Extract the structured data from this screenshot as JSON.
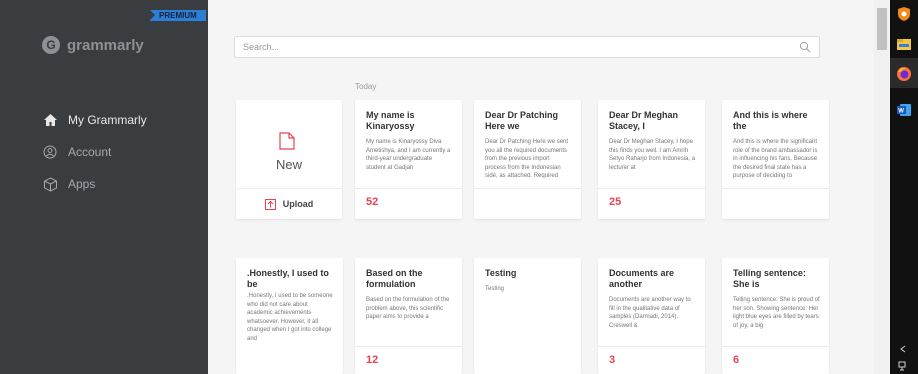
{
  "sidebar": {
    "premium_badge": "PREMIUM",
    "logo_text": "grammarly",
    "logo_glyph": "G",
    "items": [
      {
        "label": "My Grammarly",
        "icon": "home-icon"
      },
      {
        "label": "Account",
        "icon": "account-icon"
      },
      {
        "label": "Apps",
        "icon": "apps-cube-icon"
      }
    ]
  },
  "search": {
    "placeholder": "Search..."
  },
  "main": {
    "section_label": "Today"
  },
  "new_card": {
    "label": "New",
    "upload_label": "Upload"
  },
  "documents": [
    {
      "title": "My name is Kinaryossy",
      "preview": "My name is Kinaryossy Diva Ametishya, and I am currently a third-year undergraduate student at Gadjah",
      "count": "52"
    },
    {
      "title": "Dear Dr Patching Here we",
      "preview": "Dear Dr Patching Here we sent you all the required documents from the previous import process from the Indonesian side, as attached. Required",
      "count": ""
    },
    {
      "title": "Dear Dr Meghan Stacey, I",
      "preview": "Dear Dr Meghan Stacey, I hope this finds you well. I am Amrih Setyo Raharjo from Indonesia, a lecturer at",
      "count": "25"
    },
    {
      "title": "And this is where the",
      "preview": "And this is where the significant role of the brand ambassador is in influencing his fans. Because the desired final state has a purpose of deciding to",
      "count": ""
    },
    {
      "title": ".Honestly, I used to be",
      "preview": ".Honestly, I used to be someone who did not care about academic achievements whatsoever. However, it all changed when I got into college and",
      "count": ""
    },
    {
      "title": "Based on the formulation",
      "preview": "Based on the formulation of the problem above, this scientific paper aims to provide a",
      "count": "12"
    },
    {
      "title": "Testing",
      "preview": "Testing",
      "count": ""
    },
    {
      "title": "Documents are another",
      "preview": "Documents are another way to fill in the qualitative data of samples (Darmadi, 2014). Creswell &",
      "count": "3"
    },
    {
      "title": "Telling sentence: She is",
      "preview": "Telling sentence: She is proud of her son. Showing sentence: Her light blue eyes are filled by tears of joy, a big",
      "count": "6"
    }
  ],
  "taskbar": {
    "apps": [
      "vpn-shield-icon",
      "file-explorer-icon",
      "firefox-icon",
      "word-icon"
    ],
    "bottom": [
      "chevron-up-icon",
      "network-icon"
    ]
  },
  "colors": {
    "sidebar": "#3a3d40",
    "premium": "#2e7dd6",
    "accent_red": "#e44554",
    "background": "#f5f5f5"
  }
}
